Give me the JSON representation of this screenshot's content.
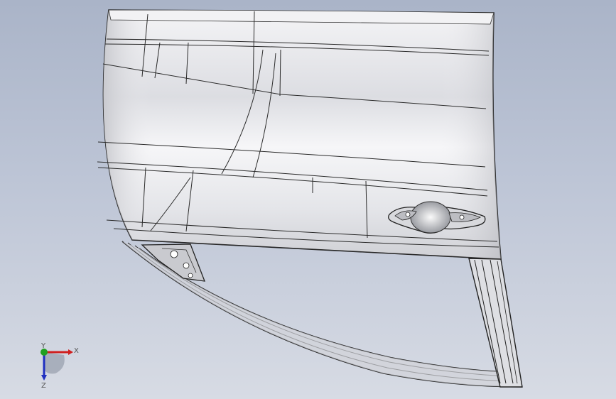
{
  "viewport": {
    "background_top": "#aab4c8",
    "background_bottom": "#d7dbe4",
    "model_fill": "#ebecee",
    "edge_color": "#1a1a1a"
  },
  "triad": {
    "x_label": "X",
    "y_label": "Y",
    "z_label": "Z",
    "x_color": "#d02020",
    "y_color": "#20a020",
    "z_color": "#2030c0"
  }
}
